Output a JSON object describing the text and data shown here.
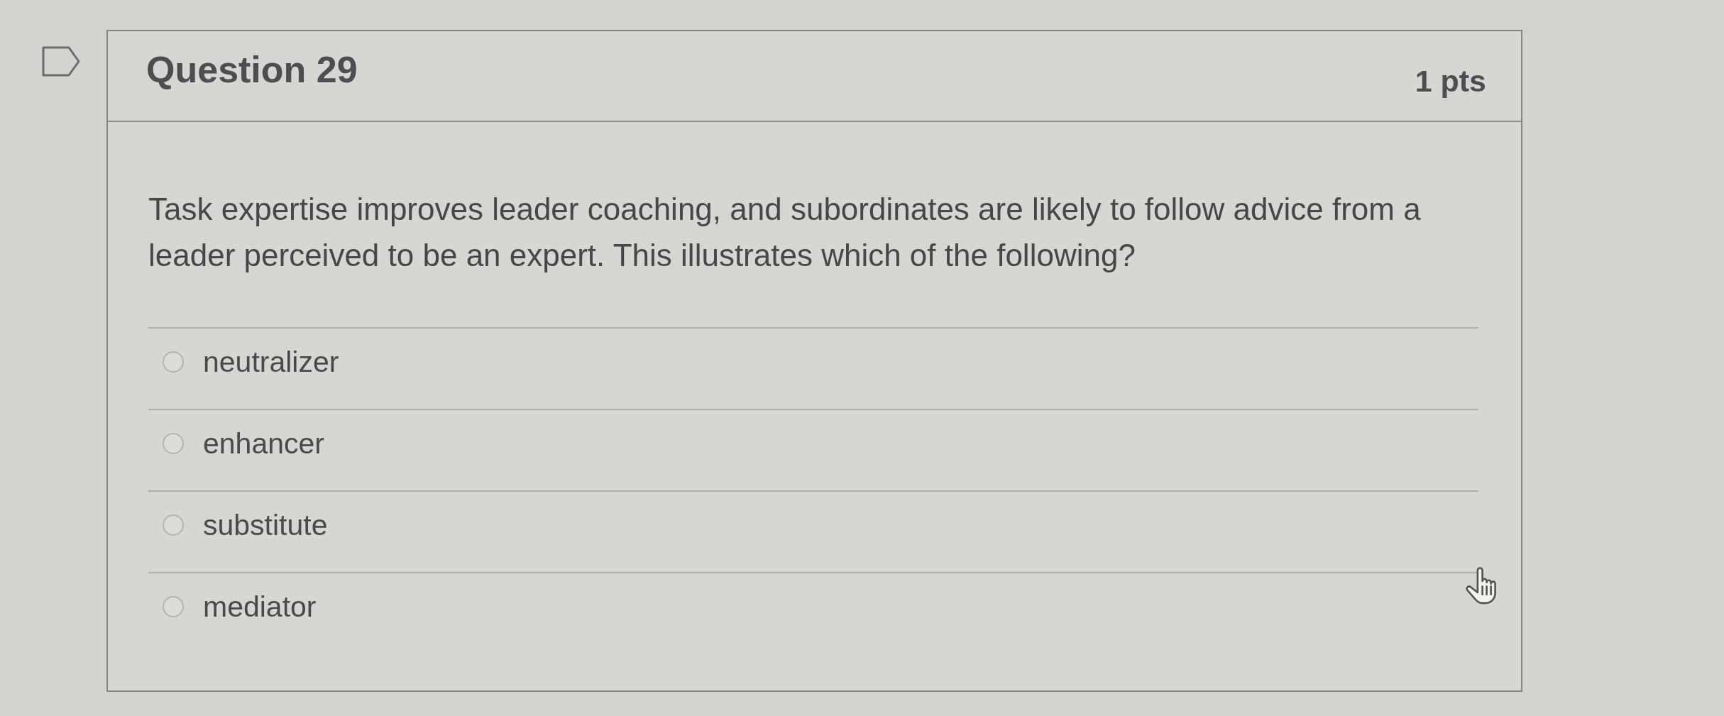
{
  "question": {
    "flagged": false,
    "title": "Question 29",
    "points": "1 pts",
    "text": "Task expertise improves leader coaching, and subordinates are likely to follow advice from a leader perceived to be an expert. This illustrates which of the following?",
    "answers": [
      {
        "label": "neutralizer",
        "selected": false
      },
      {
        "label": "enhancer",
        "selected": false
      },
      {
        "label": "substitute",
        "selected": false
      },
      {
        "label": "mediator",
        "selected": false
      }
    ]
  }
}
